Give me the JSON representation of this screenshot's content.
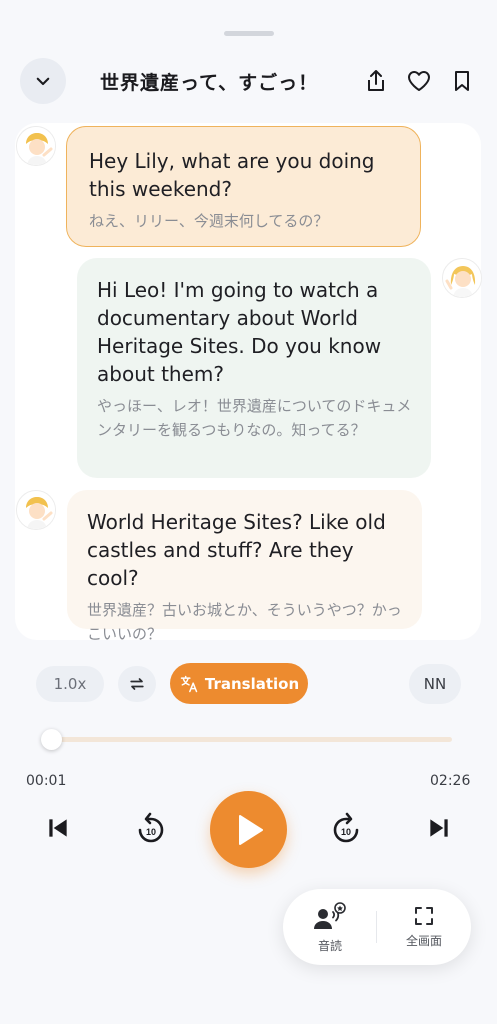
{
  "header": {
    "title": "世界遺産って、すごっ！",
    "icons": [
      "chevron-down-icon",
      "share-icon",
      "heart-icon",
      "bookmark-icon"
    ]
  },
  "messages": [
    {
      "speaker": "leo",
      "en": "Hey Lily, what are you doing this weekend?",
      "ja": "ねえ、リリー、今週末何してるの？"
    },
    {
      "speaker": "lily",
      "en": "Hi Leo! I'm going to watch a documentary about World Heritage Sites. Do you know about them?",
      "ja": "やっほー、レオ！世界遺産についてのドキュメンタリーを観るつもりなの。知ってる？"
    },
    {
      "speaker": "leo",
      "en": "World Heritage Sites? Like old castles and stuff? Are they cool?",
      "ja": "世界遺産？古いお城とか、そういうやつ？かっこいいの？"
    }
  ],
  "controls": {
    "speed": "1.0x",
    "translation_label": "Translation",
    "nn_label": "NN"
  },
  "player": {
    "current_time": "00:01",
    "total_time": "02:26",
    "progress": 0.007,
    "skip_seconds": "10"
  },
  "fab": {
    "read_aloud_label": "音読",
    "fullscreen_label": "全画面"
  },
  "colors": {
    "accent": "#ed8b2f",
    "bubble_leo": "#fcebd6",
    "bubble_lily": "#eff5f1",
    "bubble_leo_inactive": "#fcf6ef"
  }
}
